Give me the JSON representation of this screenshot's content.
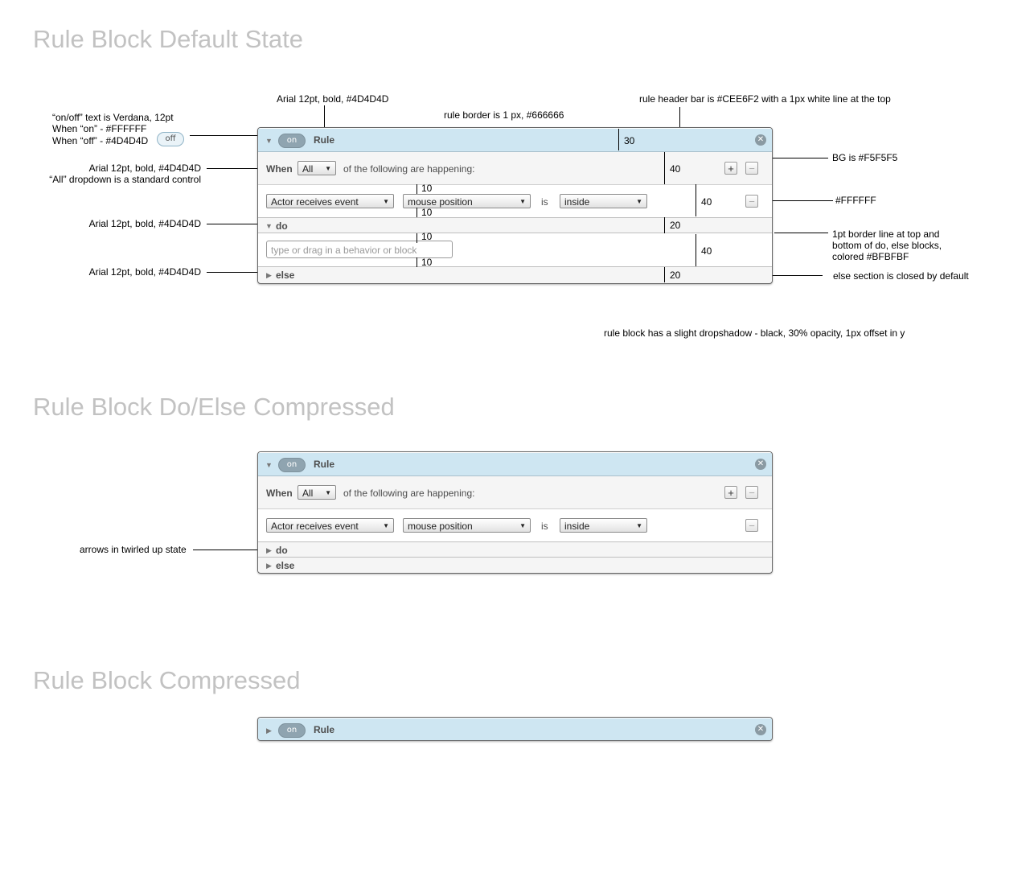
{
  "sections": {
    "default_title": "Rule Block Default State",
    "doelse_title": "Rule Block Do/Else Compressed",
    "compressed_title": "Rule Block Compressed"
  },
  "annotations": {
    "header_font": "Arial 12pt, bold, #4D4D4D",
    "border": "rule border is 1 px, #666666",
    "header_bar": "rule header bar is #CEE6F2 with a 1px white line at the top",
    "onoff_1": "“on/off” text is Verdana, 12pt",
    "onoff_2": "When “on” - #FFFFFF",
    "onoff_3": "When “off” - #4D4D4D",
    "when_1": "Arial 12pt, bold, #4D4D4D",
    "when_2": "“All” dropdown is a standard control",
    "bg": "BG is #F5F5F5",
    "white": "#FFFFFF",
    "do_font": "Arial 12pt, bold, #4D4D4D",
    "border_line_1": "1pt border line at top and",
    "border_line_2": "bottom of do, else blocks,",
    "border_line_3": "colored #BFBFBF",
    "else_font": "Arial 12pt, bold, #4D4D4D",
    "else_closed": "else section is closed by default",
    "shadow": "rule block has a slight dropshadow - black, 30% opacity, 1px offset in y",
    "arrows": "arrows in twirled up state"
  },
  "measures": {
    "header_h": "30",
    "when_h": "40",
    "cond_h": "40",
    "pad_10": "10",
    "do_h": "20",
    "body_h": "40",
    "else_h": "20"
  },
  "rule": {
    "toggle_on": "on",
    "toggle_off": "off",
    "title": "Rule",
    "close_glyph": "✕",
    "when_label": "When",
    "all_option": "All",
    "happening": "of the following are happening:",
    "plus": "+",
    "minus": "−",
    "actor_event": "Actor receives event",
    "mouse_position": "mouse position",
    "is_label": "is",
    "inside": "inside",
    "do_label": "do",
    "else_label": "else",
    "input_placeholder": "type or drag in a behavior or block"
  },
  "icons": {
    "twirl_open": "▼",
    "twirl_closed": "▶",
    "dropdown_arrow": "▼"
  }
}
